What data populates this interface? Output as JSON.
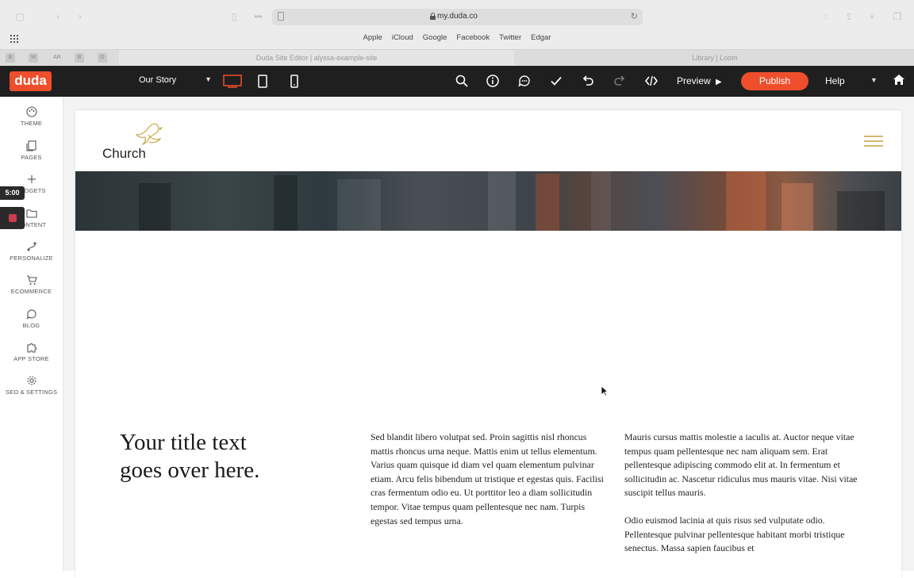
{
  "browser": {
    "url": "my.duda.co",
    "favorites": [
      "Apple",
      "iCloud",
      "Google",
      "Facebook",
      "Twitter",
      "Edgar"
    ],
    "tabs": [
      {
        "label": "Duda Site Editor | alyssa-example-site",
        "active": true
      },
      {
        "label": "Library | Loom",
        "active": false
      }
    ],
    "pinned": [
      "B",
      "W",
      "AR",
      "B",
      "G"
    ]
  },
  "toolbar": {
    "logo": "duda",
    "page_select": "Our Story",
    "preview_label": "Preview",
    "publish_label": "Publish",
    "help_label": "Help"
  },
  "sidebar": {
    "items": [
      {
        "label": "THEME",
        "icon": "palette-icon"
      },
      {
        "label": "PAGES",
        "icon": "pages-icon"
      },
      {
        "label": "WIDGETS",
        "icon": "plus-icon"
      },
      {
        "label": "CONTENT",
        "icon": "folder-icon"
      },
      {
        "label": "PERSONALIZE",
        "icon": "personalize-icon"
      },
      {
        "label": "ECOMMERCE",
        "icon": "cart-icon"
      },
      {
        "label": "BLOG",
        "icon": "chat-bubble-icon"
      },
      {
        "label": "APP STORE",
        "icon": "puzzle-icon"
      },
      {
        "label": "SEO & SETTINGS",
        "icon": "gear-icon"
      }
    ],
    "timer": "5:00"
  },
  "site": {
    "logo_text": "Church",
    "title": "Your title text goes over here.",
    "col1": "Sed blandit libero volutpat sed. Proin sagittis nisl rhoncus mattis rhoncus urna neque. Mattis enim ut tellus elementum. Varius quam quisque id diam vel quam elementum pulvinar etiam. Arcu felis bibendum ut tristique et egestas quis. Facilisi cras fermentum odio eu. Ut porttitor leo a diam sollicitudin tempor. Vitae tempus quam pellentesque nec nam. Turpis egestas sed tempus urna.",
    "col2_p1": "Mauris cursus mattis molestie a iaculis at. Auctor neque vitae tempus quam pellentesque nec nam aliquam sem. Erat pellentesque adipiscing commodo elit at. In fermentum et sollicitudin ac. Nascetur ridiculus mus mauris vitae. Nisi vitae suscipit tellus mauris.",
    "col2_p2": "Odio euismod lacinia at quis risus sed vulputate odio. Pellentesque pulvinar pellentesque habitant morbi tristique senectus. Massa sapien faucibus et"
  },
  "colors": {
    "brand": "#ee4e2b",
    "toolbar_bg": "#1f1f1f",
    "accent_gold": "#c9a13b"
  }
}
